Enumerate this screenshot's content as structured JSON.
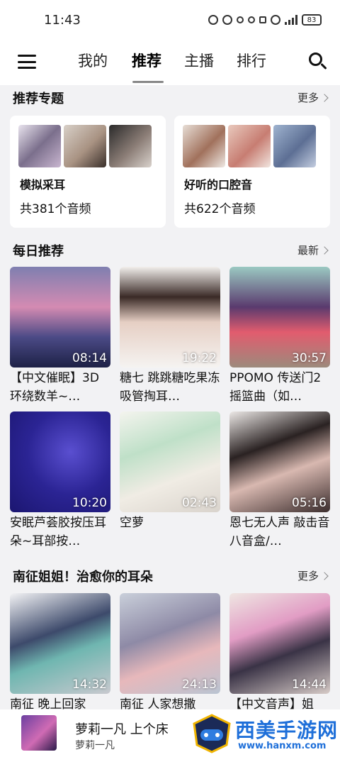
{
  "status": {
    "time": "11:43",
    "battery": "83"
  },
  "nav": {
    "tabs": [
      {
        "label": "我的"
      },
      {
        "label": "推荐",
        "active": true
      },
      {
        "label": "主播"
      },
      {
        "label": "排行"
      }
    ]
  },
  "sections": {
    "topics": {
      "title": "推荐专题",
      "more": "更多"
    },
    "daily": {
      "title": "每日推荐",
      "more": "最新"
    },
    "nanzheng": {
      "title": "南征姐姐！治愈你的耳朵",
      "more": "更多"
    }
  },
  "topics": [
    {
      "name": "模拟采耳",
      "count": "共381个音频"
    },
    {
      "name": "好听的口腔音",
      "count": "共622个音频"
    }
  ],
  "daily": [
    {
      "title": "【中文催眠】3D环绕数羊~…",
      "duration": "08:14"
    },
    {
      "title": "糖七 跳跳糖吃果冻吸管掏耳…",
      "duration": "19:22"
    },
    {
      "title": "PPOMO 传送门2摇篮曲（如…",
      "duration": "30:57"
    },
    {
      "title": "安眠芦荟胶按压耳朵~耳部按…",
      "duration": "10:20"
    },
    {
      "title": "空萝",
      "duration": "02:43"
    },
    {
      "title": "恩七无人声 敲击音八音盒/…",
      "duration": "05:16"
    }
  ],
  "nanzheng": [
    {
      "title": "南征 晚上回家",
      "duration": "14:32"
    },
    {
      "title": "南征 人家想撒",
      "duration": "24:13"
    },
    {
      "title": "【中文音声】姐",
      "duration": "14:44"
    }
  ],
  "player": {
    "title": "萝莉一凡 上个床",
    "artist": "萝莉一凡"
  },
  "watermark": {
    "text": "西美手游网",
    "url": "www.hanxm.com"
  },
  "colors": {
    "accent": "#1e6fd9",
    "background": "#f2f2f4"
  }
}
